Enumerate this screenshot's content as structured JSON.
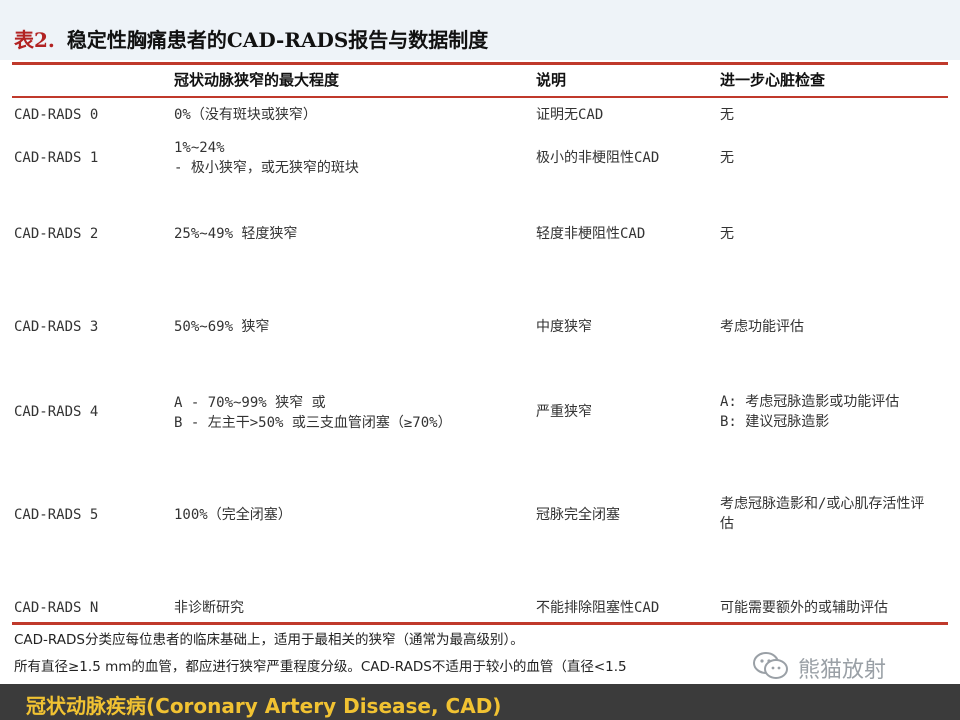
{
  "title": {
    "tag": "表2.",
    "text": "稳定性胸痛患者的CAD-RADS报告与数据制度"
  },
  "headers": [
    "",
    "冠状动脉狭窄的最大程度",
    "说明",
    "进一步心脏检查"
  ],
  "rows": [
    {
      "grade": "CAD-RADS 0",
      "stenosis": [
        "0%（没有斑块或狭窄）"
      ],
      "note": "证明无CAD",
      "exam": [
        "无"
      ]
    },
    {
      "grade": "CAD-RADS 1",
      "stenosis": [
        "1%~24%",
        "- 极小狭窄，或无狭窄的斑块"
      ],
      "note": "极小的非梗阻性CAD",
      "exam": [
        "无"
      ]
    },
    {
      "grade": "CAD-RADS 2",
      "stenosis": [
        "25%~49% 轻度狭窄"
      ],
      "note": "轻度非梗阻性CAD",
      "exam": [
        "无"
      ]
    },
    {
      "grade": "CAD-RADS 3",
      "stenosis": [
        "50%~69% 狭窄"
      ],
      "note": "中度狭窄",
      "exam": [
        "考虑功能评估"
      ]
    },
    {
      "grade": "CAD-RADS 4",
      "stenosis": [
        "A - 70%~99% 狭窄 或",
        "B - 左主干>50% 或三支血管闭塞（≥70%）"
      ],
      "note": "严重狭窄",
      "exam": [
        "A: 考虑冠脉造影或功能评估",
        "B: 建议冠脉造影"
      ]
    },
    {
      "grade": "CAD-RADS 5",
      "stenosis": [
        "100%（完全闭塞）"
      ],
      "note": "冠脉完全闭塞",
      "exam": [
        "考虑冠脉造影和/或心肌存活性评",
        "估"
      ]
    },
    {
      "grade": "CAD-RADS N",
      "stenosis": [
        "非诊断研究"
      ],
      "note": "不能排除阻塞性CAD",
      "exam": [
        "可能需要额外的或辅助评估"
      ]
    }
  ],
  "footnotes": [
    "CAD-RADS分类应每位患者的临床基础上，适用于最相关的狭窄（通常为最高级别）。",
    "所有直径≥1.5 mm的血管，都应进行狭窄严重程度分级。CAD-RADS不适用于较小的血管（直径<1.5"
  ],
  "watermark": {
    "text": "熊猫放射",
    "icon": "wechat-icon"
  },
  "footer": {
    "text": "冠状动脉疾病(Coronary Artery Disease, CAD)"
  },
  "colors": {
    "rule": "#c0392b",
    "footer_bg": "#3b3b3b",
    "footer_text": "#f1c232",
    "title_tag": "#b22222"
  }
}
